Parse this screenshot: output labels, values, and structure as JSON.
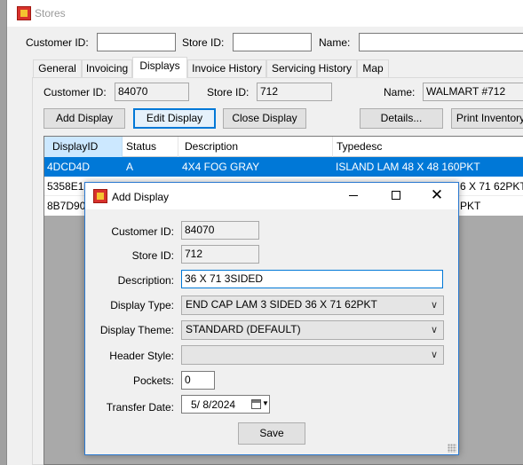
{
  "window": {
    "title": "Stores"
  },
  "search": {
    "customer_label": "Customer ID:",
    "customer_value": "",
    "store_label": "Store ID:",
    "store_value": "",
    "name_label": "Name:",
    "name_value": ""
  },
  "tabs": [
    {
      "label": "General"
    },
    {
      "label": "Invoicing"
    },
    {
      "label": "Displays"
    },
    {
      "label": "Invoice History"
    },
    {
      "label": "Servicing History"
    },
    {
      "label": "Map"
    }
  ],
  "info": {
    "customer_label": "Customer ID:",
    "customer_value": "84070",
    "store_label": "Store ID:",
    "store_value": "712",
    "name_label": "Name:",
    "name_value": "WALMART #712"
  },
  "toolbar": {
    "add_display": "Add Display",
    "edit_display": "Edit Display",
    "close_display": "Close Display",
    "details": "Details...",
    "print_inventory": "Print Inventory"
  },
  "grid": {
    "columns": [
      "DisplayID",
      "Status",
      "Description",
      "Typedesc"
    ],
    "rows": [
      {
        "id": "4DCD4D",
        "status": "A",
        "description": "4X4 FOG GRAY",
        "typedesc": "ISLAND LAM 48 X 48 160PKT"
      },
      {
        "id": "5358E1",
        "status": "",
        "description": "",
        "typedesc": "6 X 71 62PKT"
      },
      {
        "id": "8B7D90",
        "status": "",
        "description": "",
        "typedesc": "PKT"
      }
    ]
  },
  "dialog": {
    "title": "Add Display",
    "customer_label": "Customer ID:",
    "customer_value": "84070",
    "store_label": "Store ID:",
    "store_value": "712",
    "description_label": "Description:",
    "description_value": "36 X 71 3SIDED",
    "display_type_label": "Display Type:",
    "display_type_value": "END CAP LAM 3 SIDED 36 X 71 62PKT",
    "display_theme_label": "Display Theme:",
    "display_theme_value": "STANDARD (DEFAULT)",
    "header_style_label": "Header Style:",
    "header_style_value": "",
    "pockets_label": "Pockets:",
    "pockets_value": "0",
    "transfer_date_label": "Transfer Date:",
    "transfer_date_value": "5/  8/2024",
    "save_label": "Save"
  },
  "colors": {
    "accent": "#0078d7",
    "selected_row": "#0078d7",
    "dialog_border": "#2b79d0"
  }
}
